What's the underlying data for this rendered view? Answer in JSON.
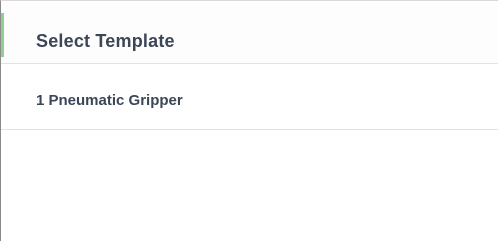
{
  "panel": {
    "title": "Select Template"
  },
  "templates": [
    {
      "label": "1 Pneumatic Gripper"
    }
  ],
  "colors": {
    "title_text": "#3c4657",
    "accent": "#8fcf8f",
    "divider": "#e3e3e3",
    "frame": "#8a8a8a"
  }
}
